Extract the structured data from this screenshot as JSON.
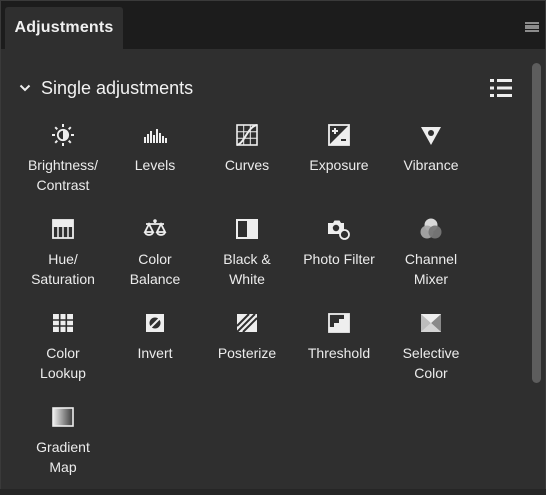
{
  "panel": {
    "tab_label": "Adjustments"
  },
  "section": {
    "title": "Single adjustments"
  },
  "items": [
    {
      "label": "Brightness/\nContrast",
      "icon": "brightness-contrast-icon"
    },
    {
      "label": "Levels",
      "icon": "levels-icon"
    },
    {
      "label": "Curves",
      "icon": "curves-icon"
    },
    {
      "label": "Exposure",
      "icon": "exposure-icon"
    },
    {
      "label": "Vibrance",
      "icon": "vibrance-icon"
    },
    {
      "label": "Hue/\nSaturation",
      "icon": "hue-saturation-icon"
    },
    {
      "label": "Color\nBalance",
      "icon": "color-balance-icon"
    },
    {
      "label": "Black &\nWhite",
      "icon": "black-white-icon"
    },
    {
      "label": "Photo Filter",
      "icon": "photo-filter-icon"
    },
    {
      "label": "Channel\nMixer",
      "icon": "channel-mixer-icon"
    },
    {
      "label": "Color\nLookup",
      "icon": "color-lookup-icon"
    },
    {
      "label": "Invert",
      "icon": "invert-icon"
    },
    {
      "label": "Posterize",
      "icon": "posterize-icon"
    },
    {
      "label": "Threshold",
      "icon": "threshold-icon"
    },
    {
      "label": "Selective\nColor",
      "icon": "selective-color-icon"
    },
    {
      "label": "Gradient\nMap",
      "icon": "gradient-map-icon"
    }
  ]
}
